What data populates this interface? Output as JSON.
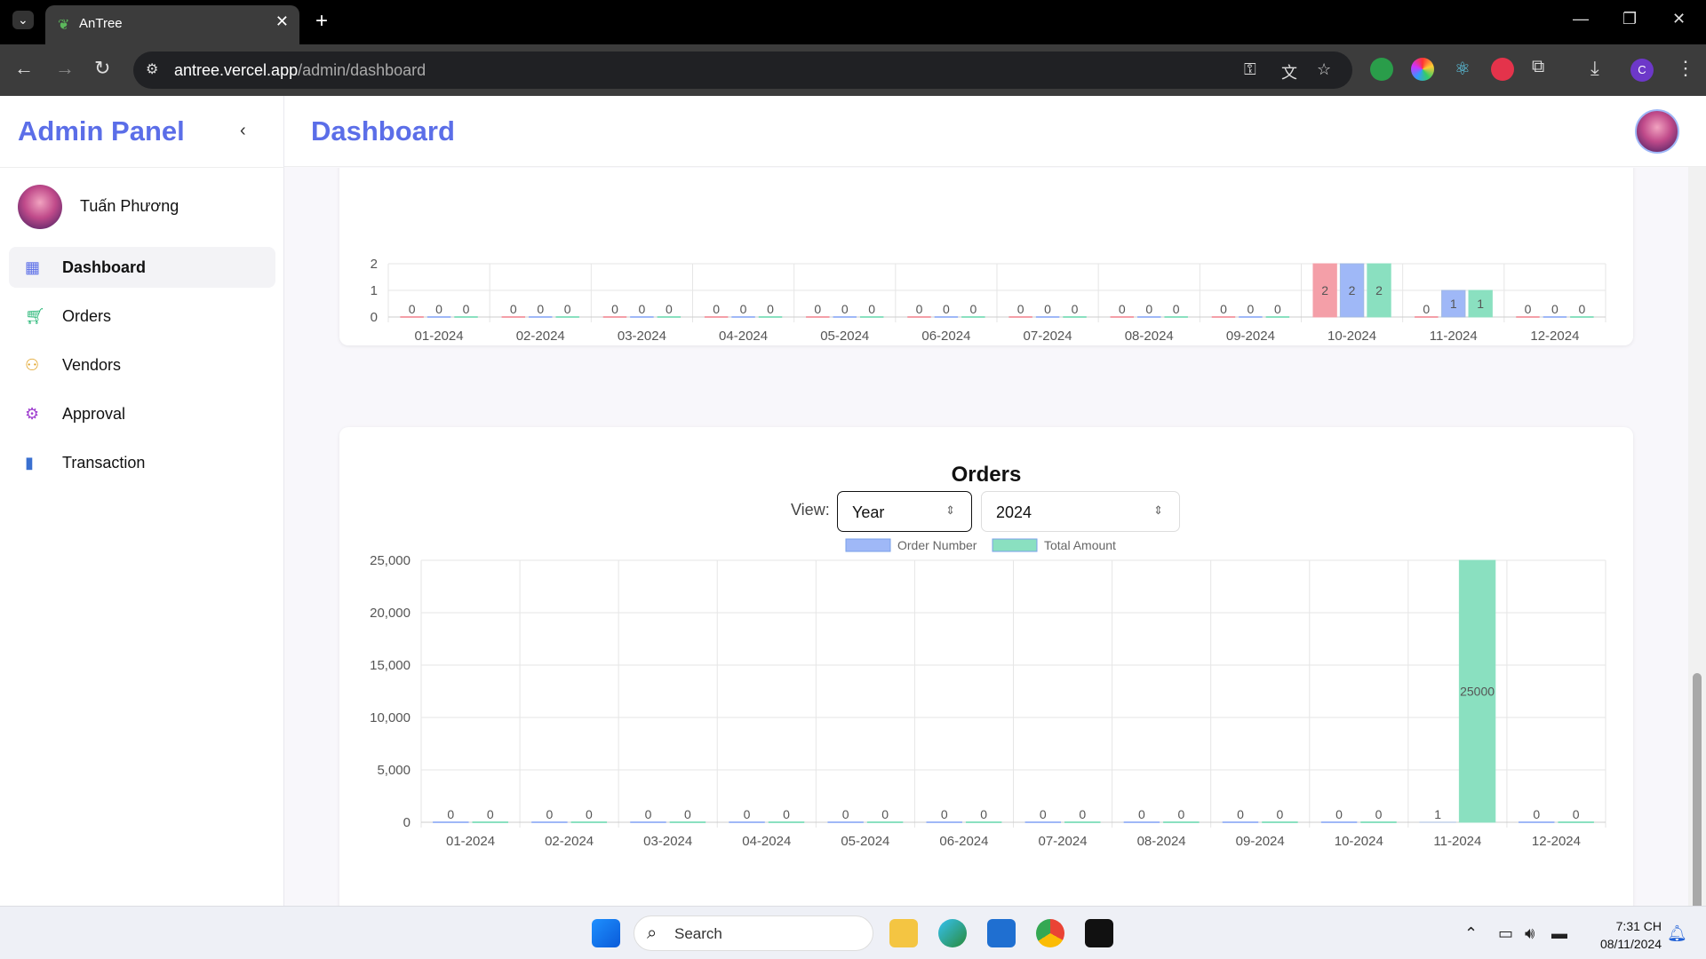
{
  "browser": {
    "tab_title": "AnTree",
    "url_host": "antree.vercel.app",
    "url_path": "/admin/dashboard",
    "profile_initial": "C"
  },
  "sidebar": {
    "brand": "Admin Panel",
    "user_name": "Tuấn Phương",
    "items": [
      {
        "label": "Dashboard",
        "icon": "grid-icon",
        "active": true
      },
      {
        "label": "Orders",
        "icon": "cart-icon"
      },
      {
        "label": "Vendors",
        "icon": "users-icon"
      },
      {
        "label": "Approval",
        "icon": "gear-icon"
      },
      {
        "label": "Transaction",
        "icon": "bar-chart-icon"
      }
    ]
  },
  "header": {
    "title": "Dashboard"
  },
  "orders": {
    "title": "Orders",
    "view_label": "View:",
    "view_value": "Year",
    "year_value": "2024"
  },
  "colors": {
    "brand": "#5b6ee8",
    "blue": "#9fb8f7",
    "green": "#8ae0c0",
    "red": "#f49fa8"
  },
  "chart_data": [
    {
      "type": "bar",
      "title": "",
      "categories": [
        "01-2024",
        "02-2024",
        "03-2024",
        "04-2024",
        "05-2024",
        "06-2024",
        "07-2024",
        "08-2024",
        "09-2024",
        "10-2024",
        "11-2024",
        "12-2024"
      ],
      "series": [
        {
          "values": [
            0,
            0,
            0,
            0,
            0,
            0,
            0,
            0,
            0,
            2,
            0,
            0
          ],
          "color": "#f49fa8"
        },
        {
          "values": [
            0,
            0,
            0,
            0,
            0,
            0,
            0,
            0,
            0,
            2,
            1,
            0
          ],
          "color": "#9fb8f7"
        },
        {
          "values": [
            0,
            0,
            0,
            0,
            0,
            0,
            0,
            0,
            0,
            2,
            1,
            0
          ],
          "color": "#8ae0c0"
        }
      ],
      "yticks": [
        "0",
        "1",
        "2"
      ],
      "note": "partially scrolled out of view"
    },
    {
      "type": "bar",
      "title": "Orders",
      "categories": [
        "01-2024",
        "02-2024",
        "03-2024",
        "04-2024",
        "05-2024",
        "06-2024",
        "07-2024",
        "08-2024",
        "09-2024",
        "10-2024",
        "11-2024",
        "12-2024"
      ],
      "series": [
        {
          "name": "Order Number",
          "values": [
            0,
            0,
            0,
            0,
            0,
            0,
            0,
            0,
            0,
            0,
            1,
            0
          ],
          "color": "#9fb8f7"
        },
        {
          "name": "Total Amount",
          "values": [
            0,
            0,
            0,
            0,
            0,
            0,
            0,
            0,
            0,
            0,
            25000,
            0
          ],
          "color": "#8ae0c0"
        }
      ],
      "ylim": [
        0,
        25000
      ],
      "yticks": [
        "0",
        "5,000",
        "10,000",
        "15,000",
        "20,000",
        "25,000"
      ],
      "legend": "top"
    }
  ],
  "taskbar": {
    "search_label": "Search",
    "time": "7:31 CH",
    "date": "08/11/2024"
  }
}
